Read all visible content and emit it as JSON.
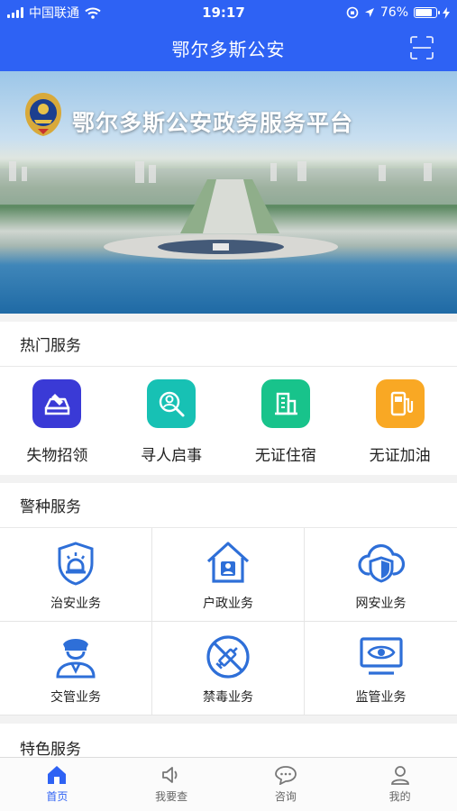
{
  "status_bar": {
    "carrier": "中国联通",
    "time": "19:17",
    "battery": "76%",
    "battery_level": 0.76
  },
  "header": {
    "title": "鄂尔多斯公安",
    "scan_icon": "scan-icon"
  },
  "banner": {
    "title": "鄂尔多斯公安政务服务平台",
    "emblem_icon": "police-emblem-icon"
  },
  "hot_services": {
    "title": "热门服务",
    "items": [
      {
        "label": "失物招领",
        "icon": "lost-found-icon",
        "color": "#3a3ad6"
      },
      {
        "label": "寻人启事",
        "icon": "search-person-icon",
        "color": "#17c1b4"
      },
      {
        "label": "无证住宿",
        "icon": "hotel-icon",
        "color": "#18c38b"
      },
      {
        "label": "无证加油",
        "icon": "fuel-icon",
        "color": "#f9a824"
      }
    ]
  },
  "police_services": {
    "title": "警种服务",
    "items": [
      {
        "label": "治安业务",
        "icon": "shield-alarm-icon"
      },
      {
        "label": "户政业务",
        "icon": "house-person-icon"
      },
      {
        "label": "网安业务",
        "icon": "cloud-shield-icon"
      },
      {
        "label": "交管业务",
        "icon": "traffic-officer-icon"
      },
      {
        "label": "禁毒业务",
        "icon": "no-drugs-icon"
      },
      {
        "label": "监管业务",
        "icon": "monitor-eye-icon"
      }
    ]
  },
  "special_services": {
    "title": "特色服务"
  },
  "tabbar": {
    "items": [
      {
        "label": "首页",
        "icon": "home-icon",
        "active": true
      },
      {
        "label": "我要查",
        "icon": "speaker-icon",
        "active": false
      },
      {
        "label": "咨询",
        "icon": "chat-icon",
        "active": false
      },
      {
        "label": "我的",
        "icon": "user-icon",
        "active": false
      }
    ]
  },
  "colors": {
    "brand": "#2e62f4",
    "icon_blue": "#2e6fd8"
  }
}
